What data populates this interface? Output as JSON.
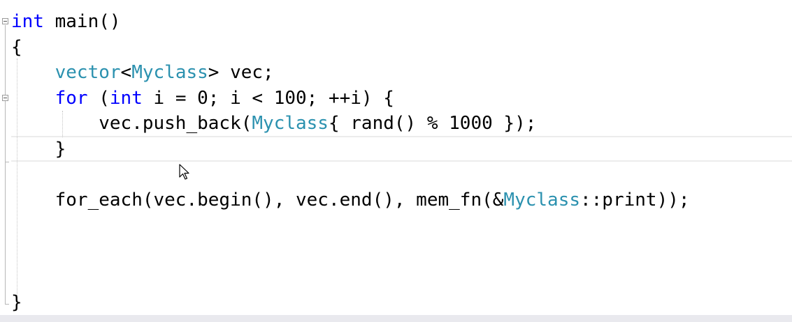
{
  "code": {
    "line_1": {
      "kw": "int",
      "rest": " main()"
    },
    "line_2": {
      "text": "{"
    },
    "line_3": {
      "indent": "    ",
      "type": "vector",
      "a": "<",
      "type2": "Myclass",
      "b": "> vec;"
    },
    "line_4": {
      "indent": "    ",
      "kw": "for",
      "a": " (",
      "kw2": "int",
      "b": " i = 0; i < 100; ++i) {"
    },
    "line_5": {
      "indent": "        ",
      "a": "vec.push_back(",
      "type": "Myclass",
      "b": "{ rand() % 1000 });"
    },
    "line_6": {
      "indent": "    ",
      "text": "}"
    },
    "line_7": {
      "text": ""
    },
    "line_8": {
      "indent": "    ",
      "a": "for_each(vec.begin(), vec.end(), mem_fn(&",
      "type": "Myclass",
      "b": "::print));"
    },
    "line_9": {
      "text": "}"
    }
  },
  "colors": {
    "keyword": "#0000ff",
    "type": "#2b91af",
    "text": "#000000",
    "background": "#ffffff"
  },
  "icons": {
    "fold": "collapse-minus-icon",
    "cursor": "mouse-pointer-icon"
  }
}
